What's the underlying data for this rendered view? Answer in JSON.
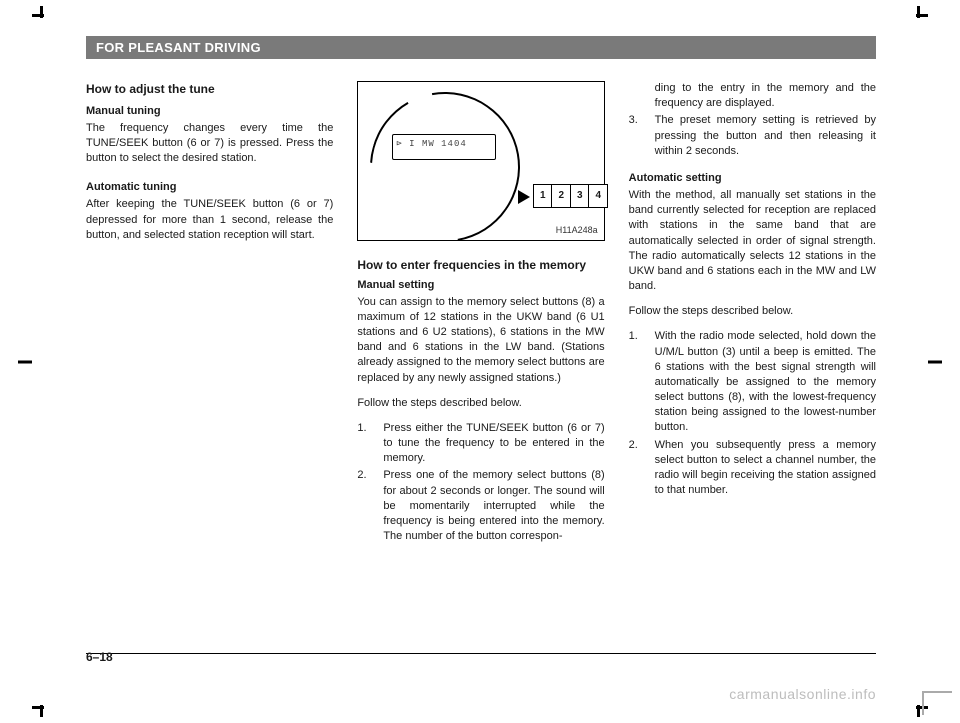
{
  "header": {
    "title": "FOR PLEASANT DRIVING"
  },
  "col1": {
    "h_adjust": "How to adjust the tune",
    "h_manual": "Manual tuning",
    "p_manual": "The frequency changes every time the TUNE/SEEK button (6 or 7) is pressed. Press the button to select the desired station.",
    "h_auto": "Automatic tuning",
    "p_auto": "After keeping the TUNE/SEEK button (6 or 7) depressed for more than 1 second, release the button, and selected station reception will start."
  },
  "figure": {
    "lcd": "⊳ I  MW  1404",
    "buttons": [
      "1",
      "2",
      "3",
      "4"
    ],
    "label": "H11A248a"
  },
  "col2": {
    "h_enter": "How to enter frequencies in the memory",
    "h_mset": "Manual setting",
    "p_mset": "You can assign to the memory select buttons (8) a maximum of 12 stations in the UKW band (6 U1 stations and 6 U2 stations), 6 stations in the MW band and 6 stations in the LW band. (Stations already assigned to the memory select buttons are replaced by any newly assigned stations.)",
    "p_follow": "Follow the steps described below.",
    "steps": [
      "Press either the TUNE/SEEK button (6 or 7) to tune the frequency to be entered in the memory.",
      "Press one of the memory select buttons (8) for about 2 seconds or longer. The sound will be momentarily interrupted while the frequency is being entered into the memory.\nThe number of the button correspon-"
    ]
  },
  "col3": {
    "cont": [
      "ding to the entry in the memory and the frequency are displayed.",
      "The preset memory setting is retrieved by pressing the button and then releasing it within 2 seconds."
    ],
    "h_aset": "Automatic setting",
    "p_aset": "With the method, all manually set stations in the band currently selected for reception are replaced with stations in the same band that are automatically selected in order of signal strength. The radio automatically selects 12 stations in the UKW band and 6 stations each in the MW and LW band.",
    "p_follow": "Follow the steps described below.",
    "steps": [
      "With the radio mode selected, hold down the U/M/L button (3) until a beep is emitted. The 6 stations with the best signal strength will automatically be assigned to the memory select buttons (8), with the lowest-frequency station being assigned to the lowest-number button.",
      "When you subsequently press a memory select button to select a channel number, the radio will begin receiving the station assigned to that number."
    ]
  },
  "page_number": "6–18",
  "watermark": "carmanualsonline.info"
}
